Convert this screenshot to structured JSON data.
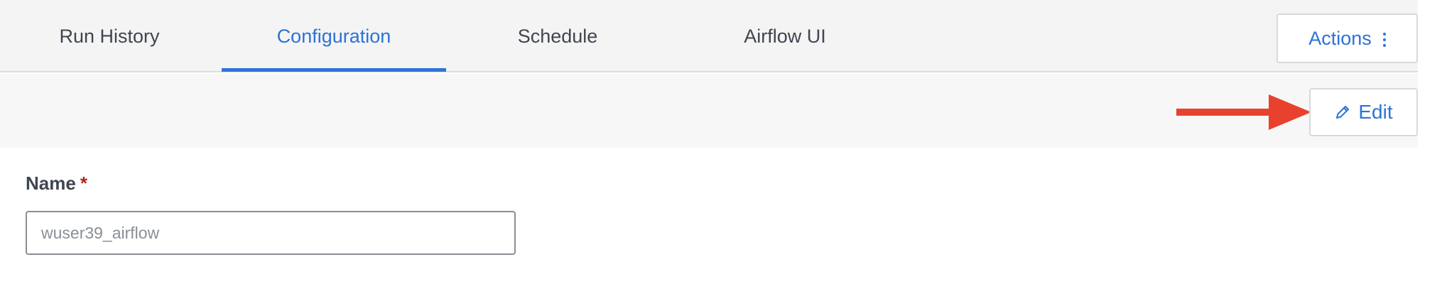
{
  "tabs": [
    {
      "label": "Run History",
      "active": false
    },
    {
      "label": "Configuration",
      "active": true
    },
    {
      "label": "Schedule",
      "active": false
    },
    {
      "label": "Airflow UI",
      "active": false
    }
  ],
  "header": {
    "actions_label": "Actions",
    "actions_icon": "kebab-menu-icon"
  },
  "toolbar": {
    "edit_label": "Edit",
    "edit_icon": "pencil-icon",
    "annotation_icon": "red-arrow-icon"
  },
  "form": {
    "name_label": "Name",
    "name_required_mark": "*",
    "name_value": "wuser39_airflow"
  },
  "colors": {
    "accent": "#2b73d6",
    "annotation_arrow": "#e8422e",
    "required": "#b3261e"
  }
}
